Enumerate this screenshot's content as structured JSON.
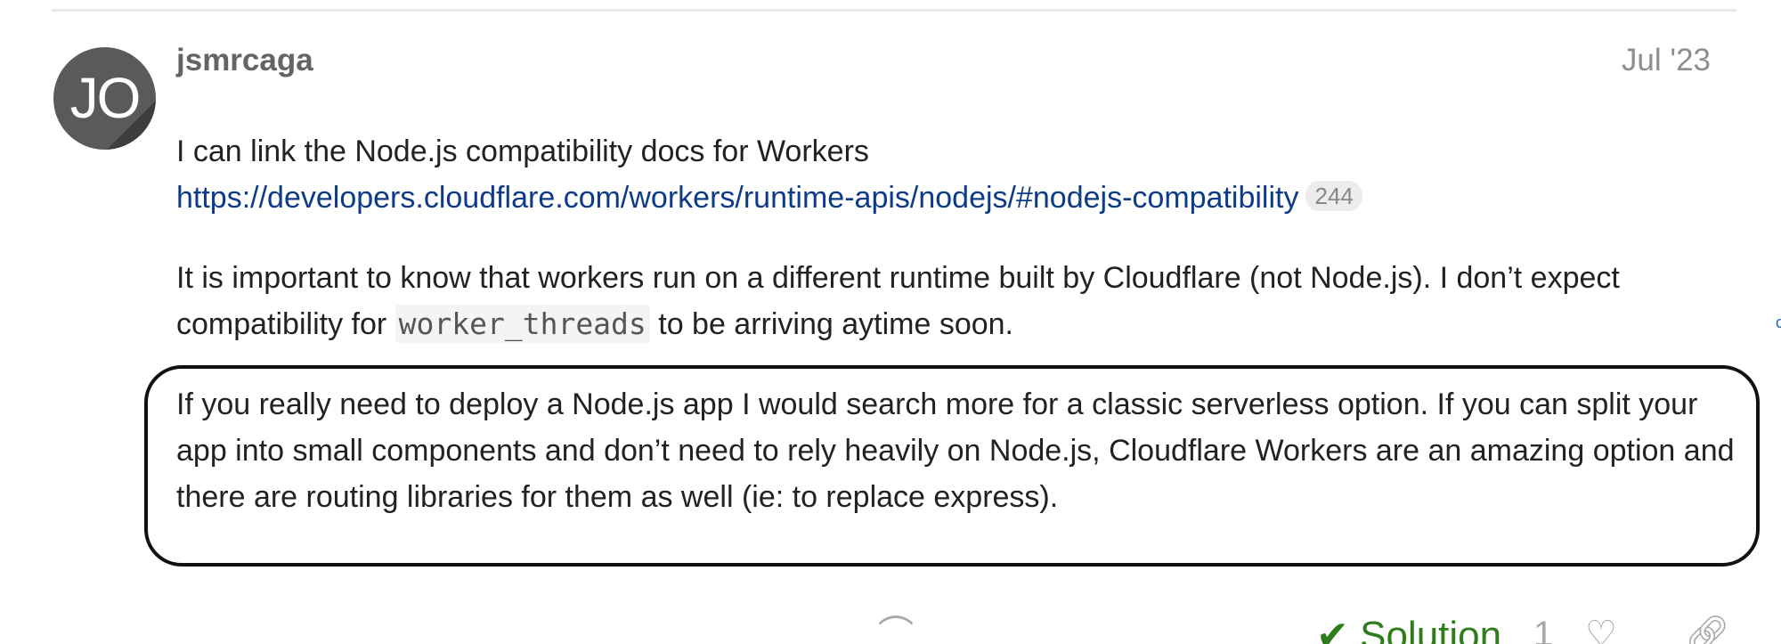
{
  "post": {
    "avatar_letters": "JO",
    "username": "jsmrcaga",
    "date": "Jul '23",
    "paragraph1_text": "I can link the Node.js compatibility docs for Workers",
    "link_text": "https://developers.cloudflare.com/workers/runtime-apis/nodejs/#nodejs-compatibility",
    "link_clicks": "244",
    "paragraph2_before": "It is important to know that workers run on a different runtime built by Cloudflare (not Node.js). I don’t expect compatibility for ",
    "paragraph2_code": "worker_threads",
    "paragraph2_after": " to be arriving aytime soon.",
    "paragraph3_text": "If you really need to deploy a Node.js app I would search more for a classic serverless option. If you can split your app into small components and don’t need to rely heavily on Node.js, Cloudflare Workers are an amazing option and there are routing libraries for them as well (ie: to replace express)."
  },
  "actions": {
    "solution_label": "Solution",
    "like_count": "1"
  },
  "icons": {
    "solution": "check-icon",
    "like": "heart-icon",
    "link": "link-icon",
    "reply": "reply-icon",
    "avatar": "avatar-icon"
  },
  "colors": {
    "link": "#0d3b8a",
    "username": "#646464",
    "date": "#8e8e8e",
    "solution": "#2e7d1a",
    "avatar_bg": "#5a5a5a",
    "highlight_border": "#111111"
  }
}
